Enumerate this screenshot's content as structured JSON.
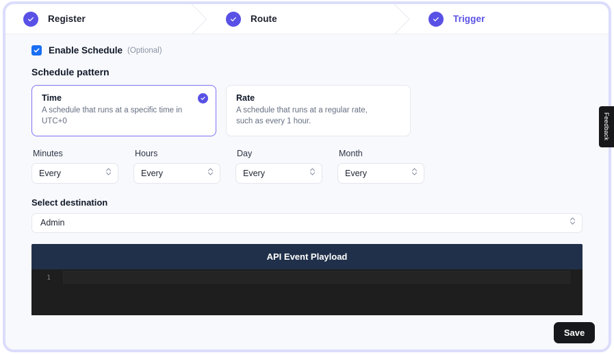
{
  "steps": [
    {
      "label": "Register",
      "state": "complete",
      "icon": "check-circle-icon"
    },
    {
      "label": "Route",
      "state": "complete",
      "icon": "check-circle-icon"
    },
    {
      "label": "Trigger",
      "state": "active",
      "icon": "check-circle-icon"
    }
  ],
  "enable_schedule": {
    "label": "Enable Schedule",
    "optional": "(Optional)",
    "checked": true
  },
  "schedule_pattern": {
    "title": "Schedule pattern",
    "options": [
      {
        "title": "Time",
        "description": "A schedule that runs at a specific time in UTC+0",
        "selected": true
      },
      {
        "title": "Rate",
        "description": "A schedule that runs at a regular rate, such as every 1 hour.",
        "selected": false
      }
    ]
  },
  "cron_fields": [
    {
      "label": "Minutes",
      "value": "Every"
    },
    {
      "label": "Hours",
      "value": "Every"
    },
    {
      "label": "Day",
      "value": "Every"
    },
    {
      "label": "Month",
      "value": "Every"
    }
  ],
  "destination": {
    "label": "Select destination",
    "value": "Admin"
  },
  "editor": {
    "title": "API Event Playload",
    "line_numbers": [
      "1"
    ],
    "content": ""
  },
  "footer": {
    "save_label": "Save"
  },
  "feedback": {
    "label": "Feedback"
  },
  "colors": {
    "accent_purple": "#5951e5",
    "checkbox_blue": "#1a6ff2",
    "editor_header": "#20304a",
    "editor_body": "#1e1e1e",
    "save_button": "#17181b",
    "ring": "#dcdcfb"
  }
}
